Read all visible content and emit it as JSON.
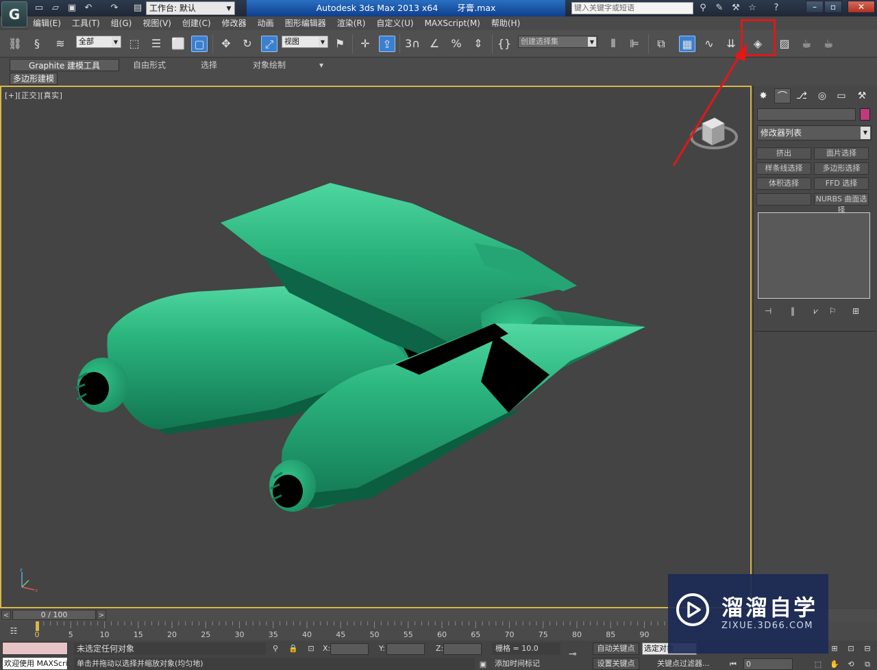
{
  "titlebar": {
    "workspace": "工作台: 默认",
    "app_name": "Autodesk 3ds Max  2013 x64",
    "file_name": "牙膏.max",
    "search_placeholder": "键入关键字或短语",
    "logo": "G"
  },
  "menu": {
    "items": [
      "编辑(E)",
      "工具(T)",
      "组(G)",
      "视图(V)",
      "创建(C)",
      "修改器",
      "动画",
      "图形编辑器",
      "渲染(R)",
      "自定义(U)",
      "MAXScript(M)",
      "帮助(H)"
    ]
  },
  "toolbar": {
    "selection_filter": "全部",
    "ref_coord": "视图",
    "selection_set_placeholder": "创建选择集",
    "snap_value": "3"
  },
  "ribbon": {
    "tabs": [
      "Graphite 建模工具",
      "自由形式",
      "选择",
      "对象绘制"
    ],
    "subtab": "多边形建模"
  },
  "viewport": {
    "label": "[+][正交][真实]",
    "object_color": "#2db07a"
  },
  "command_panel": {
    "modifier_list": "修改器列表",
    "buttons": [
      "挤出",
      "面片选择",
      "样条线选择",
      "多边形选择",
      "体积选择",
      "FFD 选择",
      "",
      "NURBS 曲面选择"
    ],
    "object_color": "#c03a7e"
  },
  "timeline": {
    "position": "0 / 100",
    "ticks": [
      "0",
      "5",
      "10",
      "15",
      "20",
      "25",
      "30",
      "35",
      "40",
      "45",
      "50",
      "55",
      "60",
      "65",
      "70",
      "75",
      "80",
      "85",
      "90"
    ]
  },
  "status": {
    "welcome": "欢迎使用 MAXScri",
    "message": "未选定任何对象",
    "prompt": "单击并拖动以选择并缩放对象(均匀地)",
    "x_label": "X:",
    "y_label": "Y:",
    "z_label": "Z:",
    "grid": "栅格 = 10.0",
    "add_time_tag": "添加时间标记",
    "auto_key": "自动关键点",
    "set_key": "设置关键点",
    "key_selection": "选定对象",
    "key_filters": "关键点过滤器...",
    "frame": "0"
  },
  "watermark": {
    "title": "溜溜自学",
    "subtitle": "ZIXUE.3D66.COM"
  },
  "colors": {
    "highlight": "#e01818",
    "viewport_border": "#d9b848",
    "title_active": "#1f5db3"
  }
}
